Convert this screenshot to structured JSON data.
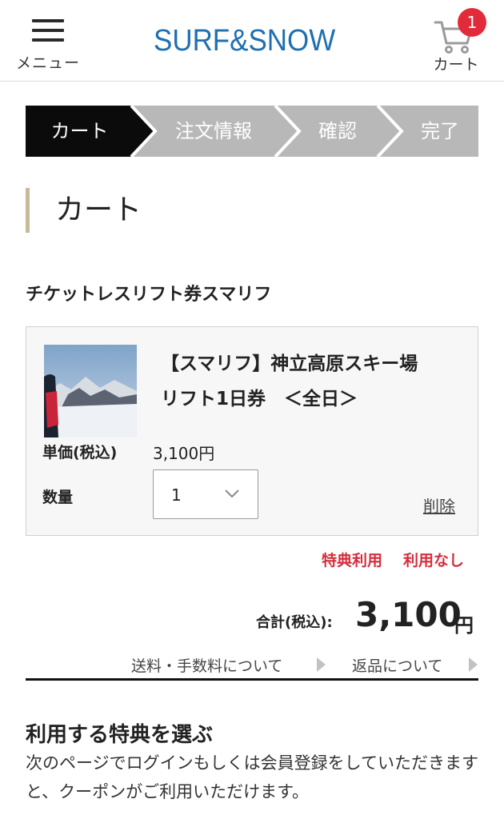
{
  "header": {
    "menu_label": "メニュー",
    "logo_text": "SURF&SNOW",
    "cart_label": "カート",
    "cart_count": "1",
    "brand_color": "#1f6fb0",
    "badge_color": "#e22b3a"
  },
  "steps": [
    {
      "label": "カート",
      "active": true
    },
    {
      "label": "注文情報",
      "active": false
    },
    {
      "label": "確認",
      "active": false
    },
    {
      "label": "完了",
      "active": false
    }
  ],
  "page_title": "カート",
  "section_heading": "チケットレスリフト券スマリフ",
  "product": {
    "name_line1": "【スマリフ】神立高原スキー場",
    "name_line2": "リフト1日券　＜全日＞",
    "image_icon": "ski-resort-photo",
    "price_label": "単価(税込)",
    "price_value": "3,100円",
    "qty_label": "数量",
    "qty_value": "1",
    "delete_label": "削除"
  },
  "benefit": {
    "label": "特典利用",
    "value": "利用なし",
    "color": "#d42e3b"
  },
  "total": {
    "label": "合計(税込):",
    "amount": "3,100",
    "unit": "円"
  },
  "links": {
    "shipping": "送料・手数料について",
    "returns": "返品について"
  },
  "select_benefit": {
    "heading": "利用する特典を選ぶ",
    "description": "次のページでログインもしくは会員登録をしていただきますと、クーポンがご利用いただけます。"
  }
}
